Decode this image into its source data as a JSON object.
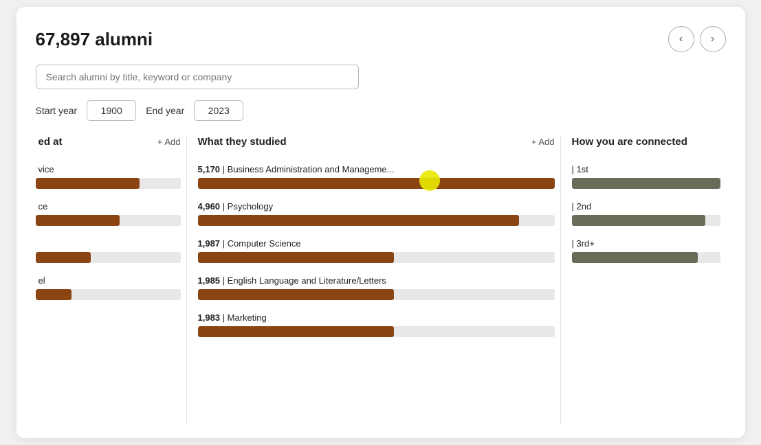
{
  "header": {
    "alumni_count": "67,897 alumni",
    "nav_prev": "‹",
    "nav_next": "›"
  },
  "search": {
    "placeholder": "Search alumni by title, keyword or company"
  },
  "years": {
    "start_label": "Start year",
    "start_value": "1900",
    "end_label": "End year",
    "end_value": "2023"
  },
  "columns": {
    "col1": {
      "title": "ed at",
      "add_label": "+ Add",
      "items": [
        {
          "label": "vice",
          "bar_pct": 72
        },
        {
          "label": "ce",
          "bar_pct": 58
        },
        {
          "label": "",
          "bar_pct": 38
        },
        {
          "label": "el",
          "bar_pct": 25
        }
      ]
    },
    "col2": {
      "title": "What they studied",
      "add_label": "+ Add",
      "items": [
        {
          "count": "5,170",
          "label": "| Business Administration and Manageme...",
          "bar_pct": 100
        },
        {
          "count": "4,960",
          "label": "| Psychology",
          "bar_pct": 90
        },
        {
          "count": "1,987",
          "label": "| Computer Science",
          "bar_pct": 55
        },
        {
          "count": "1,985",
          "label": "| English Language and Literature/Letters",
          "bar_pct": 55
        },
        {
          "count": "1,983",
          "label": "| Marketing",
          "bar_pct": 55
        }
      ]
    },
    "col3": {
      "title": "How you are connected",
      "add_label": "",
      "items": [
        {
          "label": "| 1st",
          "bar_pct": 100
        },
        {
          "label": "| 2nd",
          "bar_pct": 90
        },
        {
          "label": "| 3rd+",
          "bar_pct": 85
        }
      ]
    }
  }
}
